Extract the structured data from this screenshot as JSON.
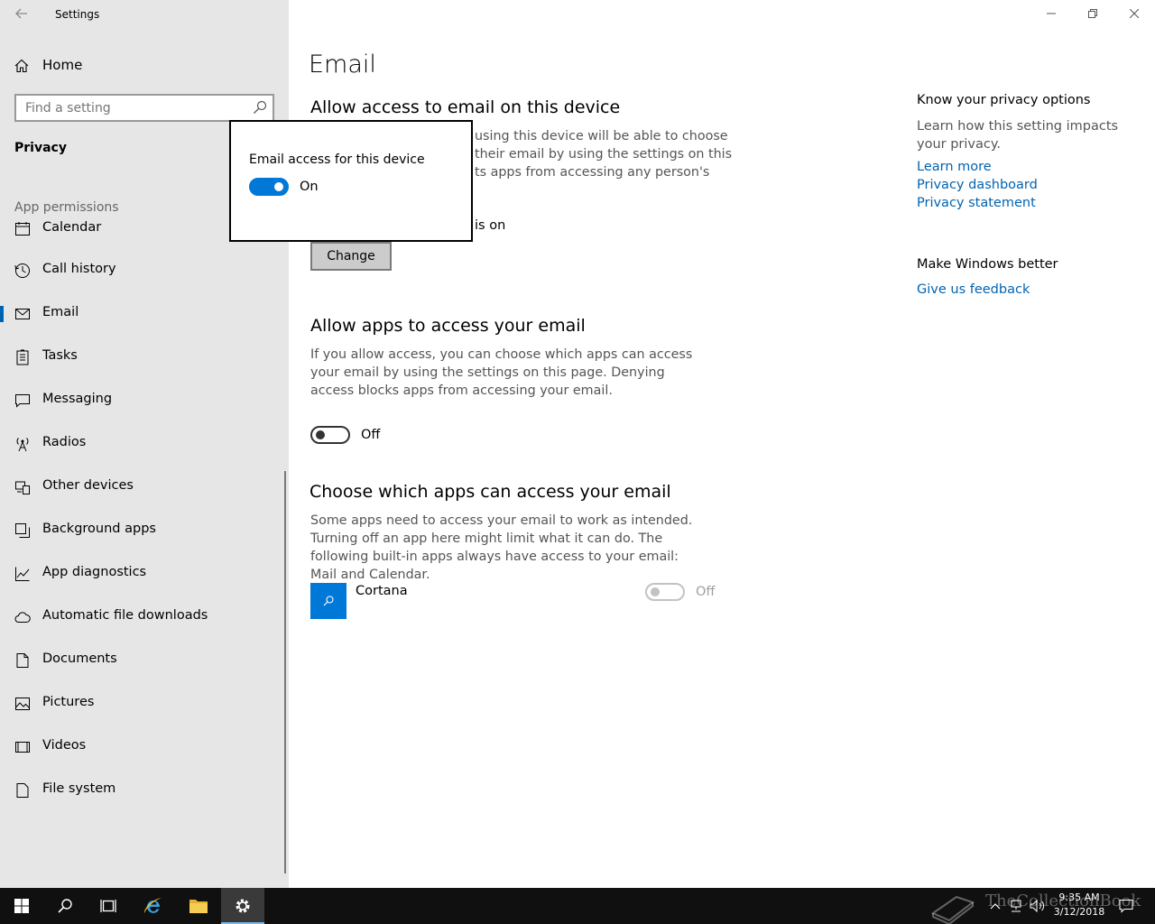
{
  "window": {
    "title": "Settings",
    "minimize": "—",
    "maximize": "❐",
    "close": "✕"
  },
  "sidebar": {
    "home_label": "Home",
    "search_placeholder": "Find a setting",
    "section_title": "Privacy",
    "group_title": "App permissions",
    "items": [
      {
        "label": "Calendar",
        "icon": "calendar-icon"
      },
      {
        "label": "Call history",
        "icon": "call-history-icon"
      },
      {
        "label": "Email",
        "icon": "email-icon",
        "selected": true
      },
      {
        "label": "Tasks",
        "icon": "tasks-icon"
      },
      {
        "label": "Messaging",
        "icon": "messaging-icon"
      },
      {
        "label": "Radios",
        "icon": "radios-icon"
      },
      {
        "label": "Other devices",
        "icon": "other-devices-icon"
      },
      {
        "label": "Background apps",
        "icon": "background-apps-icon"
      },
      {
        "label": "App diagnostics",
        "icon": "app-diagnostics-icon"
      },
      {
        "label": "Automatic file downloads",
        "icon": "cloud-icon"
      },
      {
        "label": "Documents",
        "icon": "documents-icon"
      },
      {
        "label": "Pictures",
        "icon": "pictures-icon"
      },
      {
        "label": "Videos",
        "icon": "videos-icon"
      },
      {
        "label": "File system",
        "icon": "file-system-icon"
      }
    ]
  },
  "main": {
    "page_title": "Email",
    "section1": {
      "heading": "Allow access to email on this device",
      "desc_line1": "using this device will be able to choose",
      "desc_line2": "their email by using the settings on this",
      "desc_line3": "ts apps from accessing any person's",
      "status_fragment": "is on",
      "change_button": "Change"
    },
    "section2": {
      "heading": "Allow apps to access your email",
      "description": "If you allow access, you can choose which apps can access your email by using the settings on this page. Denying access blocks apps from accessing your email.",
      "toggle_state": "Off"
    },
    "section3": {
      "heading": "Choose which apps can access your email",
      "description": "Some apps need to access your email to work as intended. Turning off an app here might limit what it can do. The following built-in apps always have access to your email: Mail and Calendar.",
      "apps": [
        {
          "name": "Cortana",
          "state": "Off"
        }
      ]
    }
  },
  "side_panel": {
    "privacy_heading": "Know your privacy options",
    "privacy_text": "Learn how this setting impacts your privacy.",
    "links": [
      "Learn more",
      "Privacy dashboard",
      "Privacy statement"
    ],
    "feedback_heading": "Make Windows better",
    "feedback_link": "Give us feedback"
  },
  "flyout": {
    "title": "Email access for this device",
    "toggle_state": "On"
  },
  "taskbar": {
    "time": "9:35 AM",
    "date": "3/12/2018",
    "watermark": "TheCollectionBook"
  },
  "colors": {
    "accent": "#0078d7",
    "link": "#0063b1",
    "sidebar_bg": "#e6e6e6",
    "taskbar_bg": "#101010"
  }
}
